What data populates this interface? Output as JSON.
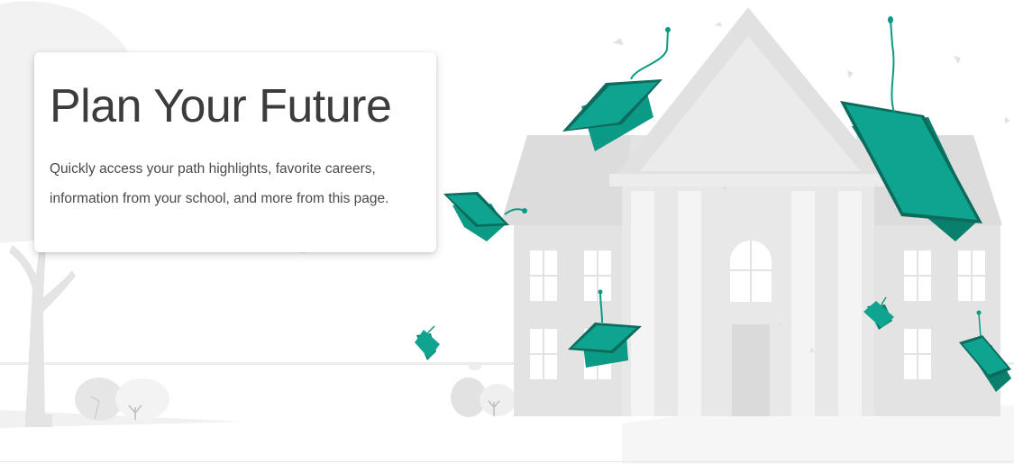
{
  "hero": {
    "title": "Plan Your Future",
    "description": "Quickly access your path highlights, favorite careers, information from your school, and more from this page."
  },
  "colors": {
    "accent": "#0a9a86",
    "accent_dark": "#097f6e",
    "cap_top": "#0d6b5d",
    "building_gray": "#e3e3e3",
    "text_dark": "#3c3c3c"
  },
  "illustration": {
    "subject": "school building with graduation caps",
    "icons": [
      "graduation-cap-icon",
      "school-building-icon",
      "tree-icon",
      "bush-icon"
    ]
  }
}
